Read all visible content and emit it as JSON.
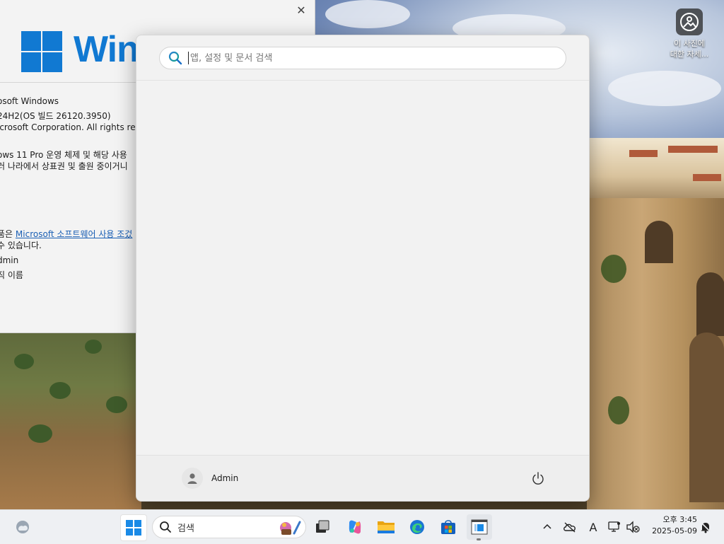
{
  "desktop": {
    "icon_label": "이 사진에\n대한 자세..."
  },
  "about_window": {
    "wordmark": "Win",
    "lines": [
      "osoft Windows",
      "24H2(OS 빌드 26120.3950)",
      "icrosoft Corporation. All rights reser",
      "ows 11 Pro 운영 체제 및 해당 사용",
      "러 나라에서 상표권 및 출원 중이거니",
      "품은",
      "Microsoft 소프트웨어 사용 조겄",
      "수 있습니다.",
      "dmin",
      "직 이름"
    ]
  },
  "start_menu": {
    "search_placeholder": "앱, 설정 및 문서 검색",
    "user_name": "Admin"
  },
  "taskbar": {
    "search_label": "검색",
    "time": "오후 3:45",
    "date": "2025-05-09",
    "ime_indicator": "A"
  },
  "colors": {
    "accent": "#1179d2",
    "link": "#1a5fb4"
  }
}
